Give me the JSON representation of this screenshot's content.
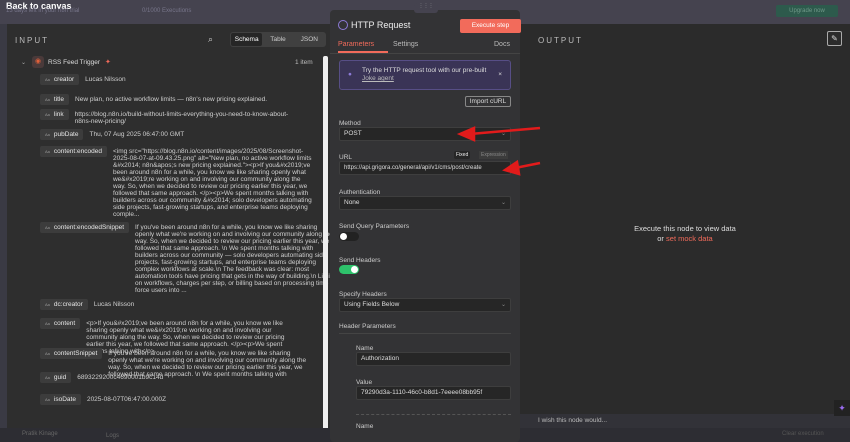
{
  "topbar": {
    "back": "Back to canvas",
    "trial": "13 days left in your n8n trial",
    "executions": "0/1000 Executions",
    "upgrade": "Upgrade now"
  },
  "input": {
    "title": "INPUT",
    "views": [
      "Schema",
      "Table",
      "JSON"
    ],
    "node": "RSS Feed Trigger",
    "count": "1 item",
    "fields": [
      {
        "key": "creator",
        "value": "Lucas Nilsson"
      },
      {
        "key": "title",
        "value": "New plan, no active workflow limits — n8n's new pricing explained."
      },
      {
        "key": "link",
        "value": "https://blog.n8n.io/build-without-limits-everything-you-need-to-know-about-n8ns-new-pricing/"
      },
      {
        "key": "pubDate",
        "value": "Thu, 07 Aug 2025 06:47:00 GMT"
      },
      {
        "key": "content:encoded",
        "value": "<img src=\"https://blog.n8n.io/content/images/2025/08/Screenshot-2025-08-07-at-09.43.25.png\" alt=\"New plan, no active workflow limits &#x2014; n8n&apos;s new pricing explained.\"><p>If you&#x2019;ve been around n8n for a while, you know we like sharing openly what we&#x2019;re working on and involving our community along the way. So, when we decided to review our pricing earlier this year, we followed that same approach. </p><p>We spent months talking with builders across our community &#x2014; solo developers automating side projects, fast-growing startups, and enterprise teams deploying comple..."
      },
      {
        "key": "content:encodedSnippet",
        "value": "If you've been around n8n for a while, you know we like sharing openly what we're working on and involving our community along the way. So, when we decided to review our pricing earlier this year, we followed that same approach. \\n We spent months talking with builders across our community — solo developers automating side projects, fast-growing startups, and enterprise teams deploying complex workflows at scale.\\n The feedback was clear: most automation tools have pricing that gets in the way of building.\\n Limits on workflows, charges per step, or billing based on processing time force users into ..."
      },
      {
        "key": "dc:creator",
        "value": "Lucas Nilsson"
      },
      {
        "key": "content",
        "value": "<p>If you&#x2019;ve been around n8n for a while, you know we like sharing openly what we&#x2019;re working on and involving our community along the way. So, when we decided to review our pricing earlier this year, we followed that same approach. </p><p>We spent months talking with</p>"
      },
      {
        "key": "contentSnippet",
        "value": "If you've been around n8n for a while, you know we like sharing openly what we're working on and involving our community along the way. So, when we decided to review our pricing earlier this year, we followed that same approach. \\n We spent months talking with"
      },
      {
        "key": "guid",
        "value": "6893229200c4690001b9c14d"
      },
      {
        "key": "isoDate",
        "value": "2025-08-07T06:47:00.000Z"
      }
    ]
  },
  "http": {
    "title": "HTTP Request",
    "execute": "Execute step",
    "tabs": [
      "Parameters",
      "Settings",
      "Docs"
    ],
    "banner": "Try the HTTP request tool with our pre-built",
    "banner_link": "Joke agent",
    "import": "Import cURL",
    "method_label": "Method",
    "method": "POST",
    "url_label": "URL",
    "fixed": "Fixed",
    "expression": "Expression",
    "url": "https://api.grigora.co/general/api/v1/cms/post/create",
    "auth_label": "Authentication",
    "auth": "None",
    "query_label": "Send Query Parameters",
    "query_on": false,
    "headers_label": "Send Headers",
    "headers_on": true,
    "specify_label": "Specify Headers",
    "specify": "Using Fields Below",
    "header_params": "Header Parameters",
    "name_label": "Name",
    "name": "Authorization",
    "value_label": "Value",
    "value": "79290d3a-1110-46c0-b8d1-7eeee08bb95f",
    "name_label2": "Name"
  },
  "output": {
    "title": "OUTPUT",
    "empty": "Execute this node to view data",
    "or": "or",
    "mock": "set mock data",
    "wish": "I wish this node would...",
    "clear": "Clear execution"
  },
  "bottom": {
    "user": "Pratik Kinage",
    "logs": "Logs"
  },
  "colors": {
    "accent": "#f26b5b",
    "toggle_on": "#2ec26b",
    "arrow": "#e21b1b"
  }
}
